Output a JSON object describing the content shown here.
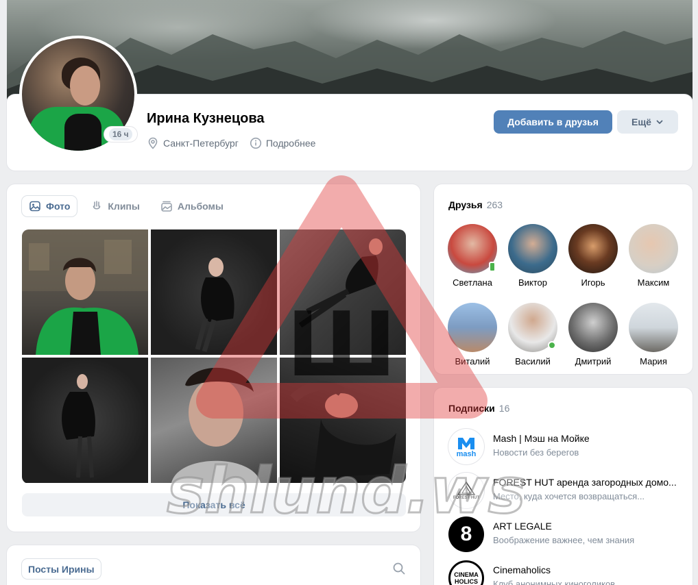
{
  "profile": {
    "name": "Ирина Кузнецова",
    "online_badge": "16 ч",
    "city": "Санкт-Петербург",
    "details_label": "Подробнее",
    "add_friend_label": "Добавить в друзья",
    "more_label": "Ещё"
  },
  "photos": {
    "tabs": [
      {
        "label": "Фото",
        "icon": "image-icon",
        "active": true
      },
      {
        "label": "Клипы",
        "icon": "clips-icon",
        "active": false
      },
      {
        "label": "Альбомы",
        "icon": "albums-icon",
        "active": false
      }
    ],
    "show_all_label": "Показать всё"
  },
  "posts": {
    "tab_label": "Посты Ирины"
  },
  "friends": {
    "title": "Друзья",
    "count": "263",
    "items": [
      {
        "name": "Светлана",
        "online": "mobile",
        "color": "#c9493f"
      },
      {
        "name": "Виктор",
        "online": "none",
        "color": "#3c6b8c"
      },
      {
        "name": "Игорь",
        "online": "none",
        "color": "#3a2a1e"
      },
      {
        "name": "Максим",
        "online": "none",
        "color": "#d8cfc4"
      },
      {
        "name": "Виталий",
        "online": "none",
        "color": "#7d9cc2"
      },
      {
        "name": "Василий",
        "online": "dot",
        "color": "#8c8a86"
      },
      {
        "name": "Дмитрий",
        "online": "none",
        "color": "#6b6b6b"
      },
      {
        "name": "Мария",
        "online": "none",
        "color": "#cfd6dc"
      }
    ]
  },
  "subscriptions": {
    "title": "Подписки",
    "count": "16",
    "items": [
      {
        "name": "Mash | Мэш на Мойке",
        "desc": "Новости без берегов",
        "logo_text": "mash",
        "logo_bg": "#ffffff",
        "logo_fg": "#1a8ef0"
      },
      {
        "name": "FOREST HUT аренда загородных домо...",
        "desc": "Место, куда хочется возвращаться...",
        "logo_text": "FOREST HUT",
        "logo_bg": "#ffffff",
        "logo_fg": "#444444"
      },
      {
        "name": "ART LEGALE",
        "desc": "Воображение важнее, чем знания",
        "logo_text": "8",
        "logo_bg": "#000000",
        "logo_fg": "#ffffff"
      },
      {
        "name": "Cinemaholics",
        "desc": "Клуб анонимных киноголиков",
        "logo_text": "CINEMA HOLICS",
        "logo_bg": "#ffffff",
        "logo_fg": "#000000"
      }
    ]
  },
  "watermark": {
    "text": "shlund.ws",
    "letter": "Ш"
  },
  "colors": {
    "accent": "#5181b8",
    "background": "#edeef0",
    "online": "#4bb34b"
  }
}
